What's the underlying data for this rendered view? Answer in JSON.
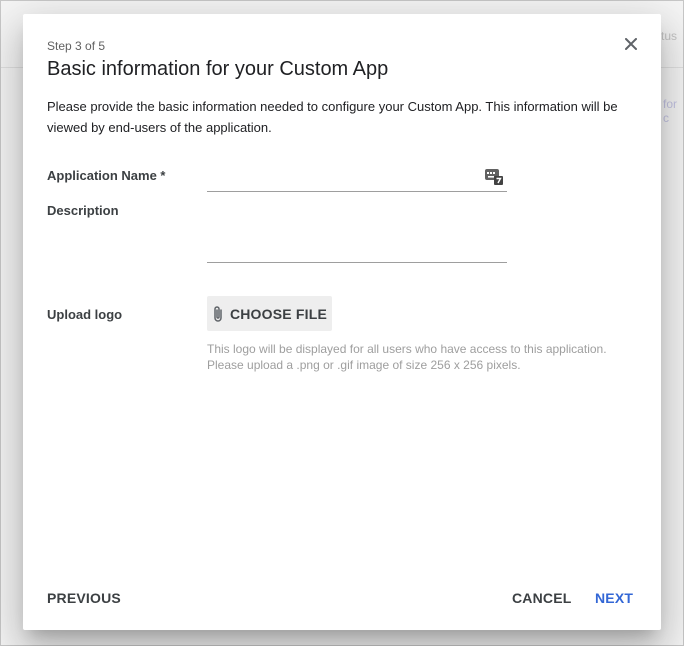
{
  "background": {
    "fragment_top": "tus",
    "fragment_mid": "for c"
  },
  "dialog": {
    "step": "Step 3 of 5",
    "title": "Basic information for your Custom App",
    "intro": "Please provide the basic information needed to configure your Custom App. This information will be viewed by end-users of the application.",
    "fields": {
      "name_label": "Application Name *",
      "name_value": "",
      "description_label": "Description",
      "description_value": "",
      "logo_label": "Upload logo",
      "choose_file": "CHOOSE FILE",
      "hint_line1": "This logo will be displayed for all users who have access to this application.",
      "hint_line2": "Please upload a .png or .gif image of size 256 x 256 pixels."
    },
    "buttons": {
      "previous": "PREVIOUS",
      "cancel": "CANCEL",
      "next": "NEXT"
    },
    "icons": {
      "close": "close-icon",
      "keyboard": "keyboard-icon",
      "attach": "paperclip-icon"
    },
    "colors": {
      "accent": "#3367d6",
      "text": "#202124",
      "muted": "#9e9e9e"
    }
  }
}
